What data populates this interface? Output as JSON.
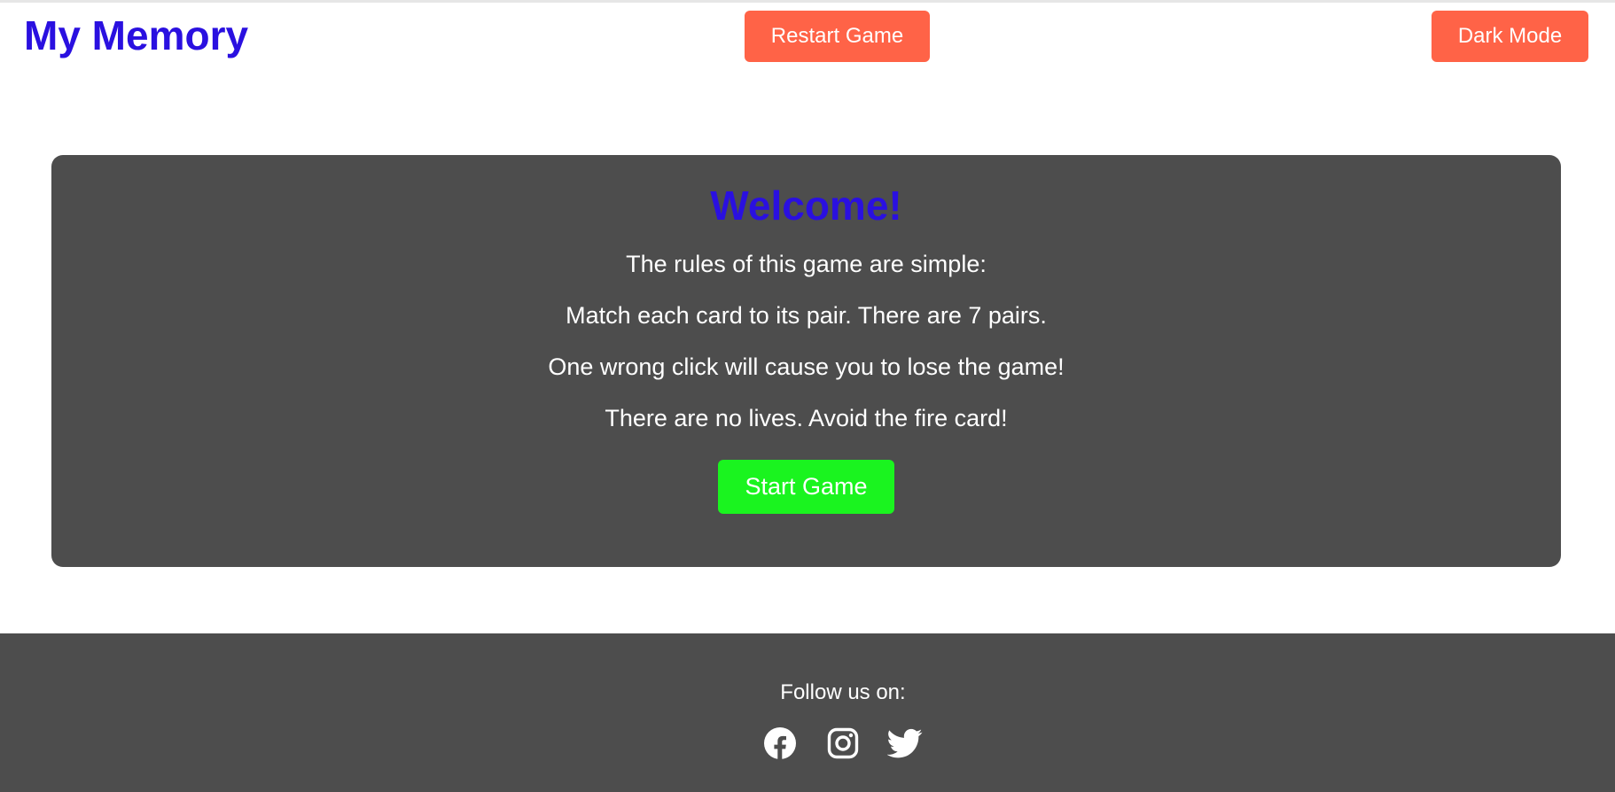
{
  "colors": {
    "brand": "#2a10e0",
    "header_button": "#ff6347",
    "panel_bg": "#4d4d4d",
    "start_button": "#1af41f",
    "footer_bg": "#4d4d4d",
    "text_light": "#ffffff"
  },
  "header": {
    "title": "My Memory",
    "restart_label": "Restart Game",
    "dark_mode_label": "Dark Mode"
  },
  "welcome": {
    "title": "Welcome!",
    "rules": [
      "The rules of this game are simple:",
      "Match each card to its pair. There are 7 pairs.",
      "One wrong click will cause you to lose the game!",
      "There are no lives. Avoid the fire card!"
    ],
    "start_label": "Start Game"
  },
  "footer": {
    "follow_text": "Follow us on:",
    "social_icons": [
      "facebook-icon",
      "instagram-icon",
      "twitter-icon"
    ]
  }
}
